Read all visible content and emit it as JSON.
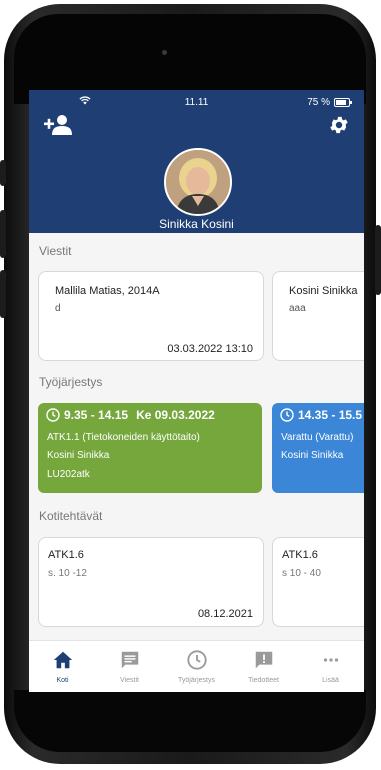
{
  "status": {
    "time": "11.11",
    "battery": "75 %"
  },
  "user": {
    "name": "Sinikka Kosini"
  },
  "messages": {
    "title": "Viestit",
    "items": [
      {
        "sender": "Mallila Matias, 2014A",
        "text": "d",
        "date": "03.03.2022 13:10"
      },
      {
        "sender": "Kosini Sinikka",
        "text": "aaa",
        "date": ""
      }
    ]
  },
  "schedule": {
    "title": "Työjärjestys",
    "items": [
      {
        "time": "9.35 - 14.15",
        "day": "Ke 09.03.2022",
        "course": "ATK1.1 (Tietokoneiden käyttötaito)",
        "teacher": "Kosini Sinikka",
        "room": "LU202atk",
        "color": "#75a73d"
      },
      {
        "time": "14.35 - 15.5",
        "day": "",
        "course": "Varattu (Varattu)",
        "teacher": "Kosini Sinikka",
        "room": "",
        "color": "#3b86d6"
      }
    ]
  },
  "homework": {
    "title": "Kotitehtävät",
    "items": [
      {
        "course": "ATK1.6",
        "pages": "s. 10 -12",
        "date": "08.12.2021"
      },
      {
        "course": "ATK1.6",
        "pages": "s 10 - 40",
        "date": ""
      }
    ]
  },
  "tabs": [
    {
      "label": "Koti",
      "icon": "home-icon",
      "active": true
    },
    {
      "label": "Viestit",
      "icon": "message-icon",
      "active": false
    },
    {
      "label": "Työjärjestys",
      "icon": "clock-icon",
      "active": false
    },
    {
      "label": "Tiedotteet",
      "icon": "announcement-icon",
      "active": false
    },
    {
      "label": "Lisää",
      "icon": "more-icon",
      "active": false
    }
  ],
  "colors": {
    "header": "#1f3f74",
    "active_tab": "#1f3f74",
    "inactive_tab": "#9a9a9a"
  }
}
